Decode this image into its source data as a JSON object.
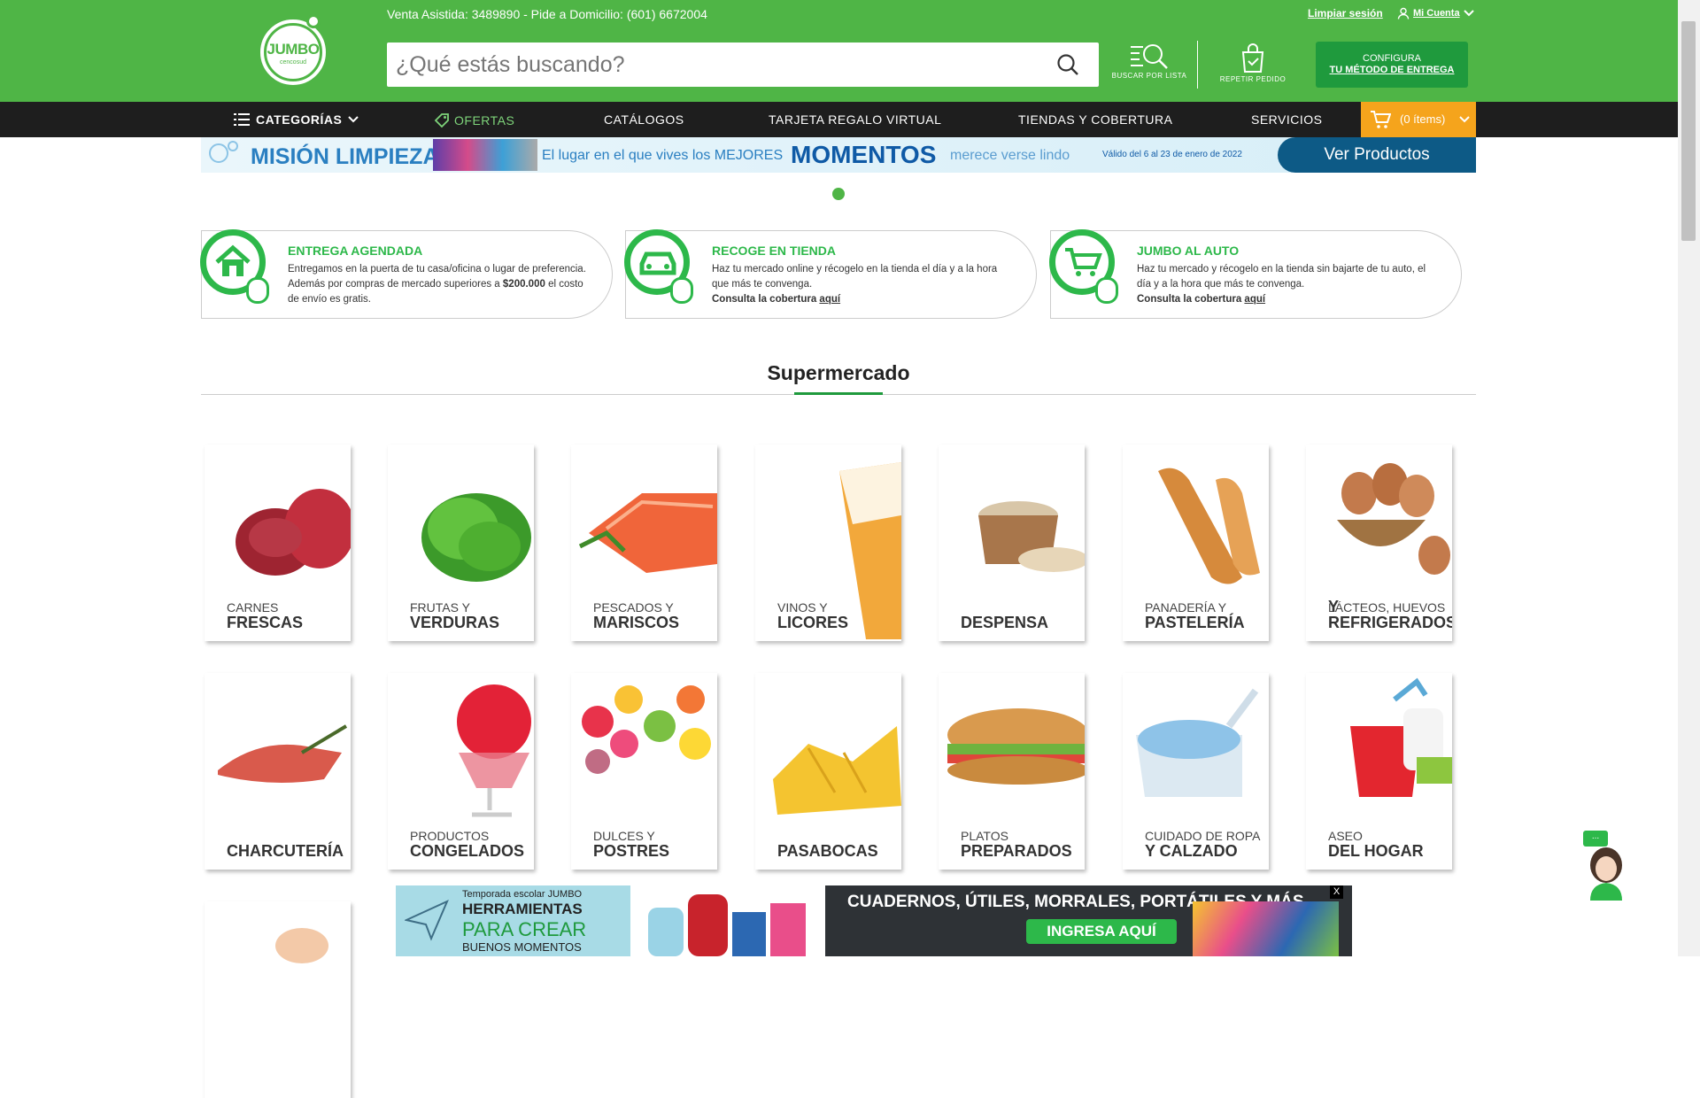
{
  "header": {
    "logo_text": "JUMBO",
    "logo_sub": "cencosud",
    "top_info": "Venta Asistida: 3489890  - Pide a Domicilio: (601) 6672004",
    "clear_session": "Limpiar sesión",
    "my_account": "Mi Cuenta",
    "search_placeholder": "¿Qué estás buscando?",
    "search_by_list": "BUSCAR POR LISTA",
    "repeat_order": "REPETIR PEDIDO",
    "config_line1": "CONFIGURA",
    "config_line2": "TU MÉTODO DE ENTREGA"
  },
  "nav": {
    "categories": "CATEGORÍAS",
    "offers": "OFERTAS",
    "catalogs": "CATÁLOGOS",
    "gift_card": "TARJETA REGALO VIRTUAL",
    "stores": "TIENDAS Y COBERTURA",
    "services": "SERVICIOS",
    "cart": "(0 ítems)"
  },
  "banner": {
    "title": "MISIÓN LIMPIEZA",
    "text1": "El lugar en el que vives los MEJORES",
    "text2": "MOMENTOS",
    "text3": "merece verse lindo",
    "valid": "Válido del 6 al 23 de enero de 2022",
    "cta": "Ver Productos"
  },
  "services": [
    {
      "title": "ENTREGA AGENDADA",
      "desc_a": "Entregamos en la puerta de tu casa/oficina o lugar de preferencia. Además por compras de mercado superiores a ",
      "desc_bold": "$200.000",
      "desc_b": " el costo de envío es gratis."
    },
    {
      "title": "RECOGE EN TIENDA",
      "desc_a": "Haz tu mercado online y récogelo en la tienda el día y a la hora que más te convenga.",
      "cov": "Consulta la cobertura ",
      "link": "aquí"
    },
    {
      "title": "JUMBO AL AUTO",
      "desc_a": "Haz tu mercado y récogelo en la tienda sin bajarte de tu auto, el día y a la hora que más te convenga.",
      "cov": "Consulta la cobertura ",
      "link": "aquí"
    }
  ],
  "section_title": "Supermercado",
  "categories": [
    {
      "small": "CARNES",
      "big": "FRESCAS"
    },
    {
      "small": "FRUTAS Y",
      "big": "VERDURAS"
    },
    {
      "small": "PESCADOS Y",
      "big": "MARISCOS"
    },
    {
      "small": "VINOS Y",
      "big": "LICORES"
    },
    {
      "small": "",
      "big": "DESPENSA"
    },
    {
      "small": "PANADERÍA Y",
      "big": "PASTELERÍA"
    },
    {
      "small": "LÁCTEOS, HUEVOS",
      "big": "Y REFRIGERADOS"
    },
    {
      "small": "",
      "big": "CHARCUTERÍA"
    },
    {
      "small": "PRODUCTOS",
      "big": "CONGELADOS"
    },
    {
      "small": "DULCES Y",
      "big": "POSTRES"
    },
    {
      "small": "",
      "big": "PASABOCAS"
    },
    {
      "small": "PLATOS",
      "big": "PREPARADOS"
    },
    {
      "small": "CUIDADO DE ROPA",
      "big": "Y CALZADO"
    },
    {
      "small": "ASEO",
      "big": "DEL HOGAR"
    }
  ],
  "promo": {
    "line1": "Temporada escolar JUMBO",
    "line2": "HERRAMIENTAS",
    "line3": "PARA CREAR",
    "line4": "BUENOS MOMENTOS",
    "headline": "CUADERNOS, ÚTILES, MORRALES, PORTÁTILES Y MÁS",
    "cta": "INGRESA AQUÍ",
    "close": "X"
  },
  "chat": {
    "bubble": "..."
  }
}
